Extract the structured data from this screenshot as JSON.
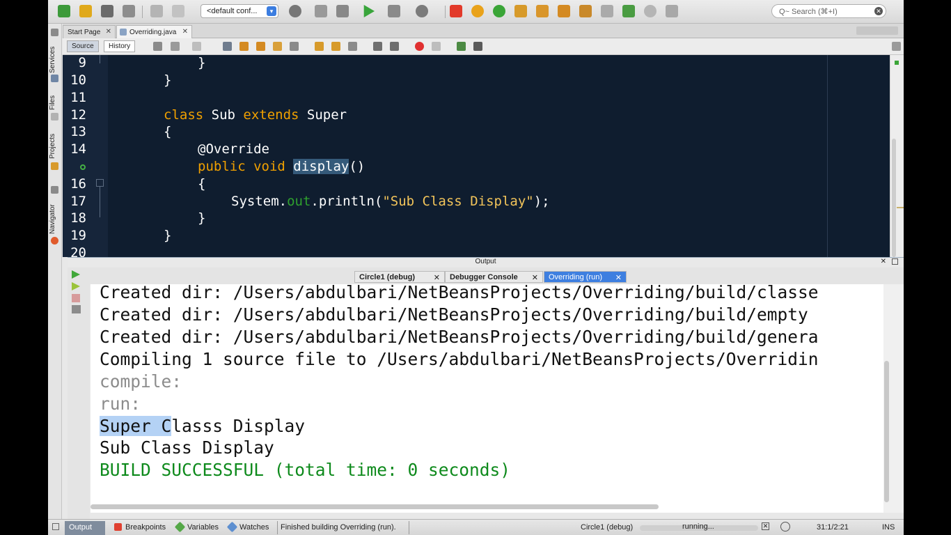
{
  "toolbar": {
    "config_value": "<default conf...",
    "search_placeholder": "Q~ Search (⌘+I)"
  },
  "side_tabs": [
    "Services",
    "Files",
    "Projects",
    "Navigator"
  ],
  "editor_tabs": [
    {
      "label": "Start Page"
    },
    {
      "label": "Overriding.java"
    }
  ],
  "editor_modes": {
    "source": "Source",
    "history": "History"
  },
  "code": {
    "line_numbers": [
      "9",
      "10",
      "11",
      "12",
      "13",
      "14",
      "",
      "16",
      "17",
      "18",
      "19",
      "20"
    ],
    "lines": {
      "l9": "}",
      "l10": "}",
      "l12_kw1": "class",
      "l12_name": " Sub ",
      "l12_kw2": "extends",
      "l12_rest": " Super",
      "l13": "{",
      "l14": "@Override",
      "l15_kw": "public void ",
      "l15_method": "display",
      "l15_rest": "()",
      "l16": "{",
      "l17_pre": "System.",
      "l17_field": "out",
      "l17_mid": ".println(",
      "l17_str": "\"Sub Class Display\"",
      "l17_end": ");",
      "l18": "}",
      "l19": "}"
    }
  },
  "output": {
    "title": "Output",
    "tabs": [
      {
        "label": "Circle1 (debug)"
      },
      {
        "label": "Debugger Console"
      },
      {
        "label": "Overriding (run)"
      }
    ],
    "lines": {
      "o1": "Created dir: /Users/abdulbari/NetBeansProjects/Overriding/build/classe",
      "o2": "Created dir: /Users/abdulbari/NetBeansProjects/Overriding/build/empty",
      "o3": "Created dir: /Users/abdulbari/NetBeansProjects/Overriding/build/genera",
      "o4": "Compiling 1 source file to /Users/abdulbari/NetBeansProjects/Overridin",
      "o5": "compile:",
      "o6": "run:",
      "o7_sel": "Super C",
      "o7_rest": "lasss Display",
      "o8": "Sub Class Display",
      "o9": "BUILD SUCCESSFUL (total time: 0 seconds)"
    }
  },
  "status": {
    "output_tab": "Output",
    "breakpoints_tab": "Breakpoints",
    "variables_tab": "Variables",
    "watches_tab": "Watches",
    "message": "Finished building Overriding (run).",
    "session": "Circle1 (debug)",
    "progress": "running...",
    "position": "31:1/2:21",
    "mode": "INS"
  },
  "colors": {
    "editor_bg": "#0f1d2f",
    "keyword": "#f0a000",
    "string": "#f2c45a",
    "field": "#2fa02f",
    "success": "#0e8a1c",
    "active_tab": "#3e7fe0"
  }
}
